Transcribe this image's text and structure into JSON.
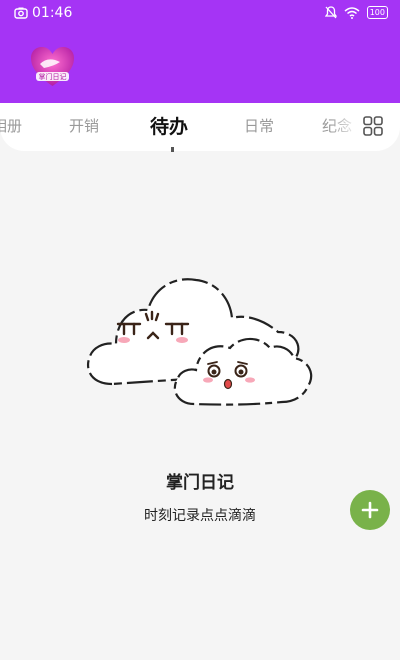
{
  "status_bar": {
    "time": "01:46",
    "battery": "100",
    "icons": [
      "camera-icon",
      "mute-icon",
      "wifi-icon",
      "battery-icon"
    ]
  },
  "app": {
    "logo_text": "掌门日记"
  },
  "tabs": [
    {
      "label": "相册",
      "active": false
    },
    {
      "label": "开销",
      "active": false
    },
    {
      "label": "待办",
      "active": true
    },
    {
      "label": "日常",
      "active": false
    },
    {
      "label": "纪念",
      "active": false
    }
  ],
  "empty_state": {
    "title": "掌门日记",
    "subtitle": "时刻记录点点滴滴"
  },
  "colors": {
    "header": "#a534f5",
    "fab": "#79b24a",
    "background": "#f5f5f5"
  }
}
